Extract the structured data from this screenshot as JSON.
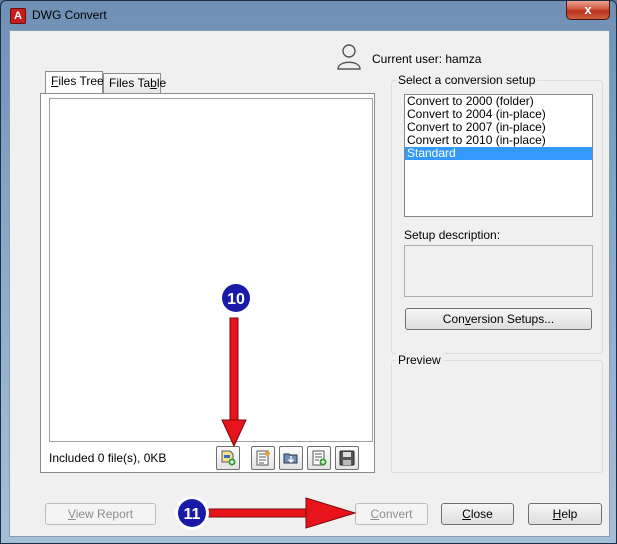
{
  "window": {
    "title": "DWG Convert",
    "close_glyph": "x"
  },
  "user": {
    "label": "Current user: hamza"
  },
  "tabs": [
    {
      "label": "Files Tree",
      "mnemonic": "F",
      "rest": "iles Tree"
    },
    {
      "label": "Files Table",
      "pre": "Files Ta",
      "mnemonic": "b",
      "rest": "le"
    }
  ],
  "files": {
    "status": "Included 0 file(s), 0KB"
  },
  "toolbar": {
    "buttons": [
      "add-file-icon",
      "list-settings-icon",
      "open-folder-icon",
      "list-add-icon",
      "save-icon"
    ]
  },
  "setup": {
    "group_label": "Select a conversion setup",
    "items": [
      {
        "label": "Convert to 2000 (folder)",
        "selected": false
      },
      {
        "label": "Convert to 2004 (in-place)",
        "selected": false
      },
      {
        "label": "Convert to 2007 (in-place)",
        "selected": false
      },
      {
        "label": "Convert to 2010 (in-place)",
        "selected": false
      },
      {
        "label": "Standard",
        "selected": true
      }
    ],
    "description_label": "Setup description:",
    "description": "",
    "conversion_setups_button": {
      "pre": "Con",
      "mnemonic": "v",
      "rest": "ersion Setups..."
    }
  },
  "preview": {
    "label": "Preview"
  },
  "footer": {
    "view_report": {
      "mnemonic": "V",
      "rest": "iew Report"
    },
    "convert": {
      "mnemonic": "C",
      "rest": "onvert"
    },
    "close": {
      "mnemonic": "C",
      "rest": "lose"
    },
    "help": {
      "mnemonic": "H",
      "rest": "elp"
    }
  },
  "annotations": [
    {
      "number": "10",
      "color": "#1a1aa8",
      "arrow_color": "#e8141b"
    },
    {
      "number": "11",
      "color": "#1a1aa8",
      "arrow_color": "#e8141b"
    }
  ]
}
